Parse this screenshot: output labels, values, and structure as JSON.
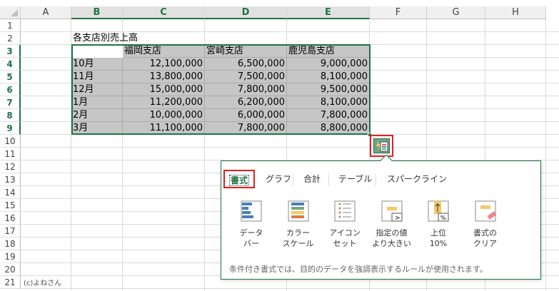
{
  "columns": [
    "A",
    "B",
    "C",
    "D",
    "E",
    "F",
    "G",
    "H"
  ],
  "rows": [
    "1",
    "2",
    "3",
    "4",
    "5",
    "6",
    "7",
    "8",
    "9",
    "10",
    "11",
    "12",
    "13",
    "14",
    "15",
    "16",
    "17",
    "18",
    "19",
    "20",
    "21"
  ],
  "title": "各支店別売上高",
  "headers": [
    "福岡支店",
    "宮崎支店",
    "鹿児島支店"
  ],
  "table": [
    [
      "10月",
      "12,100,000",
      "6,500,000",
      "9,000,000"
    ],
    [
      "11月",
      "13,800,000",
      "7,500,000",
      "8,100,000"
    ],
    [
      "12月",
      "15,000,000",
      "7,800,000",
      "9,500,000"
    ],
    [
      "1月",
      "11,200,000",
      "6,200,000",
      "8,100,000"
    ],
    [
      "2月",
      "10,000,000",
      "6,000,000",
      "7,800,000"
    ],
    [
      "3月",
      "11,100,000",
      "7,800,000",
      "8,800,000"
    ]
  ],
  "quick_analysis": {
    "tabs": [
      "書式",
      "グラフ",
      "合計",
      "テーブル",
      "スパークライン"
    ],
    "options": [
      [
        "データ",
        "バー"
      ],
      [
        "カラー",
        "スケール"
      ],
      [
        "アイコン",
        "セット"
      ],
      [
        "指定の値",
        "より大きい"
      ],
      [
        "上位",
        "10%"
      ],
      [
        "書式の",
        "クリア"
      ]
    ],
    "description": "条件付き書式では、目的のデータを強調表示するルールが使用されます。"
  },
  "credit": "(c)よねさん",
  "colors": {
    "accent": "#217346",
    "highlight": "#e02020",
    "selection": "#c6c6c6"
  }
}
